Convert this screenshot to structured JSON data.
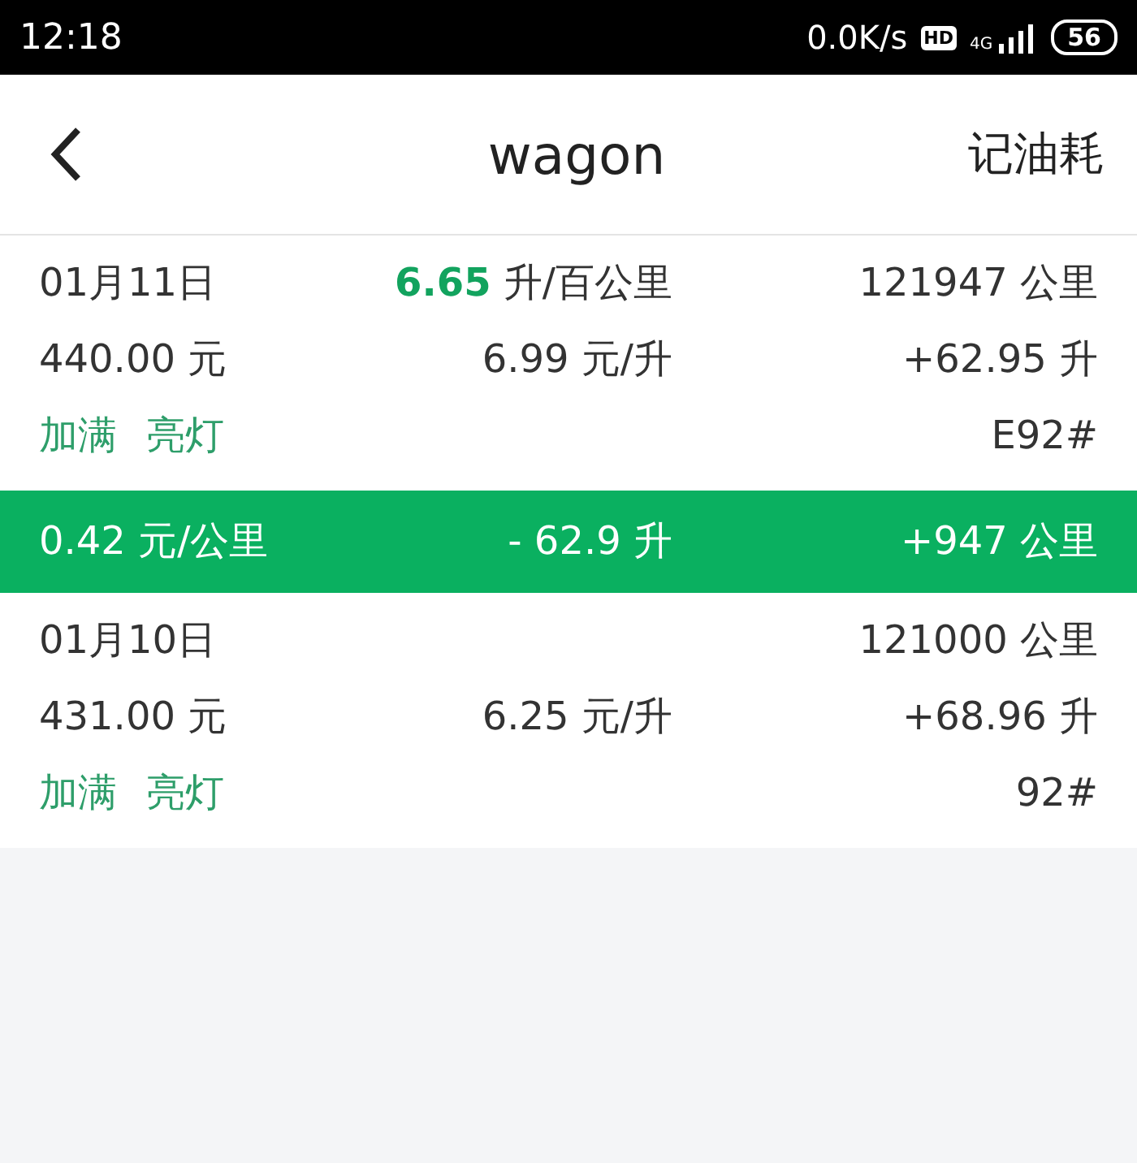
{
  "status_bar": {
    "time": "12:18",
    "speed": "0.0K/s",
    "hd_badge": "HD",
    "network": "4G",
    "battery": "56"
  },
  "header": {
    "title": "wagon",
    "action": "记油耗"
  },
  "entries": [
    {
      "kind": "refuel",
      "date": "01月11日",
      "efficiency_value": "6.65",
      "efficiency_unit": "升/百公里",
      "odometer": "121947 公里",
      "cost": "440.00 元",
      "price": "6.99 元/升",
      "volume": "+62.95 升",
      "tags": [
        "加满",
        "亮灯"
      ],
      "fuel_grade": "E92#"
    },
    {
      "kind": "summary",
      "cost_per_km": "0.42 元/公里",
      "fuel_used": "- 62.9 升",
      "distance": "+947 公里"
    },
    {
      "kind": "refuel",
      "date": "01月10日",
      "odometer": "121000 公里",
      "cost": "431.00 元",
      "price": "6.25 元/升",
      "volume": "+68.96 升",
      "tags": [
        "加满",
        "亮灯"
      ],
      "fuel_grade": "92#"
    }
  ]
}
